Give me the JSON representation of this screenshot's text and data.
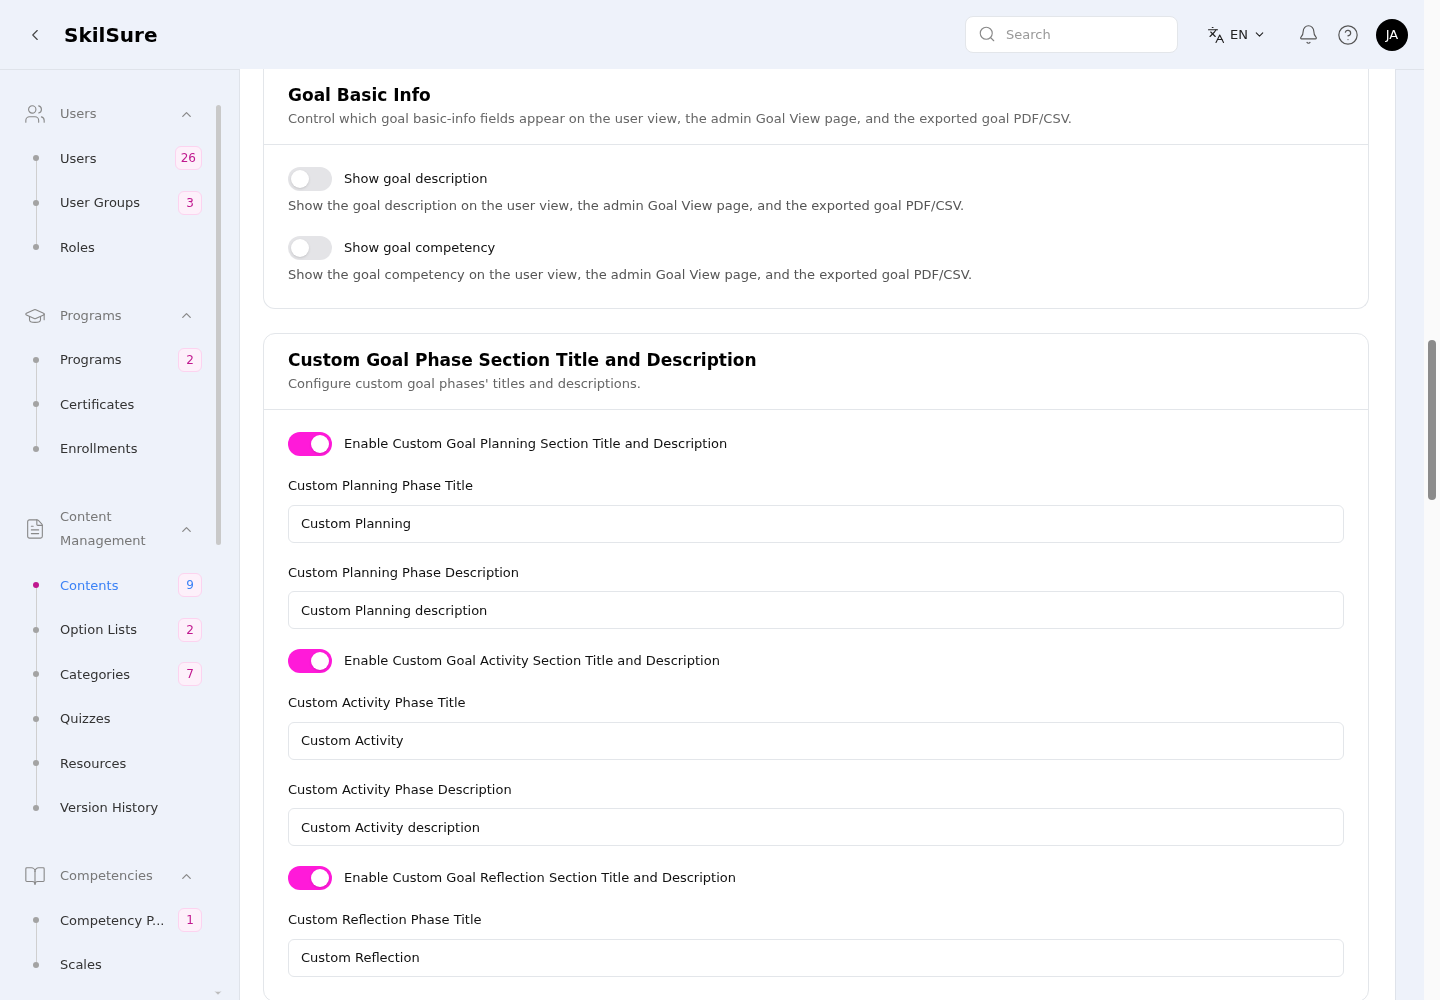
{
  "header": {
    "brand": "SkilSure",
    "search": {
      "placeholder": "Search"
    },
    "language": "EN",
    "avatar": "JA"
  },
  "sidebar": {
    "groups": [
      {
        "label": "Users",
        "expanded": true,
        "items": [
          {
            "label": "Users",
            "count": "26",
            "selected": false
          },
          {
            "label": "User Groups",
            "count": "3",
            "selected": false
          },
          {
            "label": "Roles",
            "selected": false
          }
        ]
      },
      {
        "label": "Programs",
        "expanded": true,
        "items": [
          {
            "label": "Programs",
            "count": "2",
            "selected": false
          },
          {
            "label": "Certificates",
            "selected": false
          },
          {
            "label": "Enrollments",
            "selected": false
          }
        ]
      },
      {
        "label": "Content Management",
        "expanded": true,
        "items": [
          {
            "label": "Contents",
            "count": "9",
            "selected": true
          },
          {
            "label": "Option Lists",
            "count": "2",
            "selected": false
          },
          {
            "label": "Categories",
            "count": "7",
            "selected": false
          },
          {
            "label": "Quizzes",
            "selected": false
          },
          {
            "label": "Resources",
            "selected": false
          },
          {
            "label": "Version History",
            "selected": false
          }
        ]
      },
      {
        "label": "Competencies",
        "expanded": true,
        "items": [
          {
            "label": "Competency P...",
            "count": "1",
            "selected": false
          },
          {
            "label": "Scales",
            "selected": false
          }
        ]
      }
    ]
  },
  "cards": [
    {
      "title": "Goal Basic Info",
      "description": "Control which goal basic-info fields appear on the user view, the admin Goal View page, and the exported goal PDF/CSV.",
      "settings": [
        {
          "kind": "toggle",
          "label": "Show goal description",
          "on": false,
          "help": "Show the goal description on the user view, the admin Goal View page, and the exported goal PDF/CSV."
        },
        {
          "kind": "toggle",
          "label": "Show goal competency",
          "on": false,
          "help": "Show the goal competency on the user view, the admin Goal View page, and the exported goal PDF/CSV."
        }
      ]
    },
    {
      "title": "Custom Goal Phase Section Title and Description",
      "description": "Configure custom goal phases' titles and descriptions.",
      "settings": [
        {
          "kind": "toggle",
          "label": "Enable Custom Goal Planning Section Title and Description",
          "on": true
        },
        {
          "kind": "field",
          "label": "Custom Planning Phase Title",
          "value": "Custom Planning"
        },
        {
          "kind": "field",
          "label": "Custom Planning Phase Description",
          "value": "Custom Planning description"
        },
        {
          "kind": "toggle",
          "label": "Enable Custom Goal Activity Section Title and Description",
          "on": true
        },
        {
          "kind": "field",
          "label": "Custom Activity Phase Title",
          "value": "Custom Activity"
        },
        {
          "kind": "field",
          "label": "Custom Activity Phase Description",
          "value": "Custom Activity description"
        },
        {
          "kind": "toggle",
          "label": "Enable Custom Goal Reflection Section Title and Description",
          "on": true
        },
        {
          "kind": "field",
          "label": "Custom Reflection Phase Title",
          "value": "Custom Reflection"
        }
      ]
    }
  ]
}
